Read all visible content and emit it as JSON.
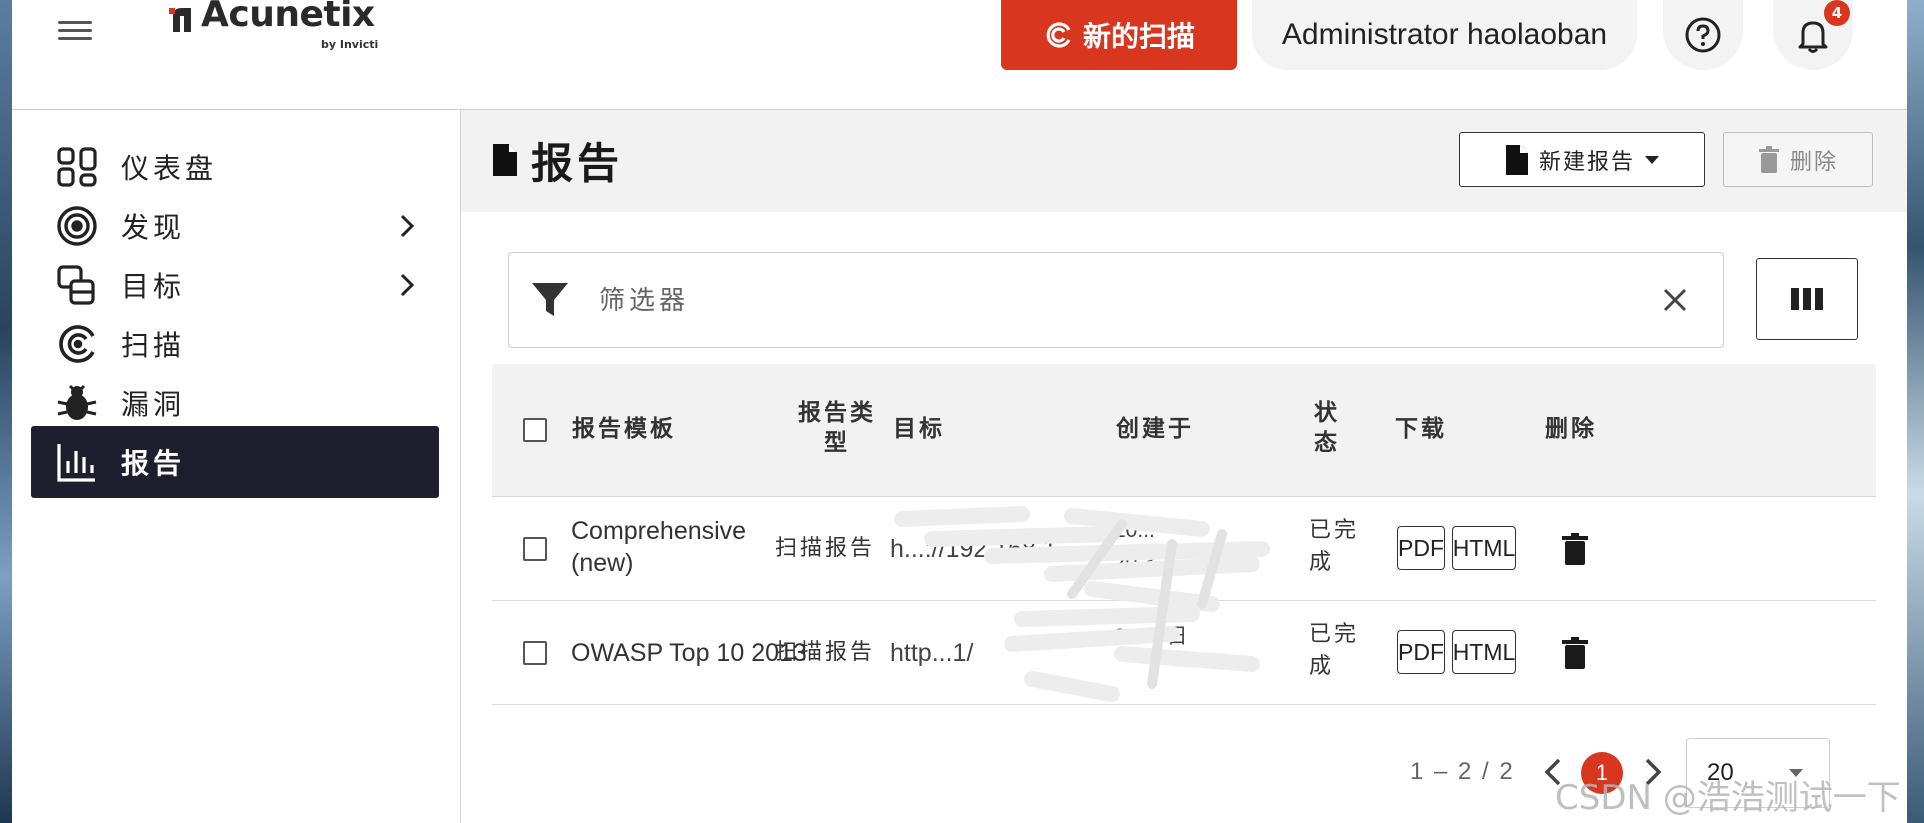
{
  "header": {
    "logo_text": "Acunetix",
    "logo_sub": "by Invicti",
    "new_scan_label": "新的扫描",
    "user_name": "Administrator haolaoban",
    "notification_count": "4"
  },
  "sidebar": {
    "items": [
      {
        "label": "仪表盘",
        "icon": "dashboard-icon",
        "has_chevron": false,
        "active": false
      },
      {
        "label": "发现",
        "icon": "target-rings-icon",
        "has_chevron": true,
        "active": false
      },
      {
        "label": "目标",
        "icon": "targets-icon",
        "has_chevron": true,
        "active": false
      },
      {
        "label": "扫描",
        "icon": "scan-icon",
        "has_chevron": false,
        "active": false
      },
      {
        "label": "漏洞",
        "icon": "bug-icon",
        "has_chevron": false,
        "active": false
      },
      {
        "label": "报告",
        "icon": "bar-chart-icon",
        "has_chevron": false,
        "active": true
      }
    ]
  },
  "main": {
    "title": "报告",
    "new_report_label": "新建报告",
    "delete_label": "删除",
    "filter_placeholder": "筛选器"
  },
  "table": {
    "headers": {
      "template": "报告模板",
      "type_line1": "报告类",
      "type_line2": "型",
      "target": "目标",
      "created": "创建于",
      "status_line1": "状",
      "status_line2": "态",
      "download": "下载",
      "delete": "删除"
    },
    "rows": [
      {
        "template_line1": "Comprehensive",
        "template_line2": "(new)",
        "type": "扫描报告",
        "target": "h...://192.168.1...",
        "created_line1": "20...",
        "created_line2": "20:3...",
        "status_line1": "已完",
        "status_line2": "成",
        "pdf_label": "PDF",
        "html_label": "HTML"
      },
      {
        "template_line1": "OWASP Top 10 2013",
        "template_line2": "",
        "type": "扫描报告",
        "target": "http...1/",
        "created_line1": "20...9日",
        "created_line2": "",
        "status_line1": "已完",
        "status_line2": "成",
        "pdf_label": "PDF",
        "html_label": "HTML"
      }
    ]
  },
  "pagination": {
    "range": "1 – 2 / 2",
    "current_page": "1",
    "page_size": "20"
  },
  "watermark": "CSDN @浩浩测试一下",
  "colors": {
    "accent": "#d9361f",
    "sidebar_active": "#1f1e2e",
    "title_bar": "#f2f2f2"
  }
}
